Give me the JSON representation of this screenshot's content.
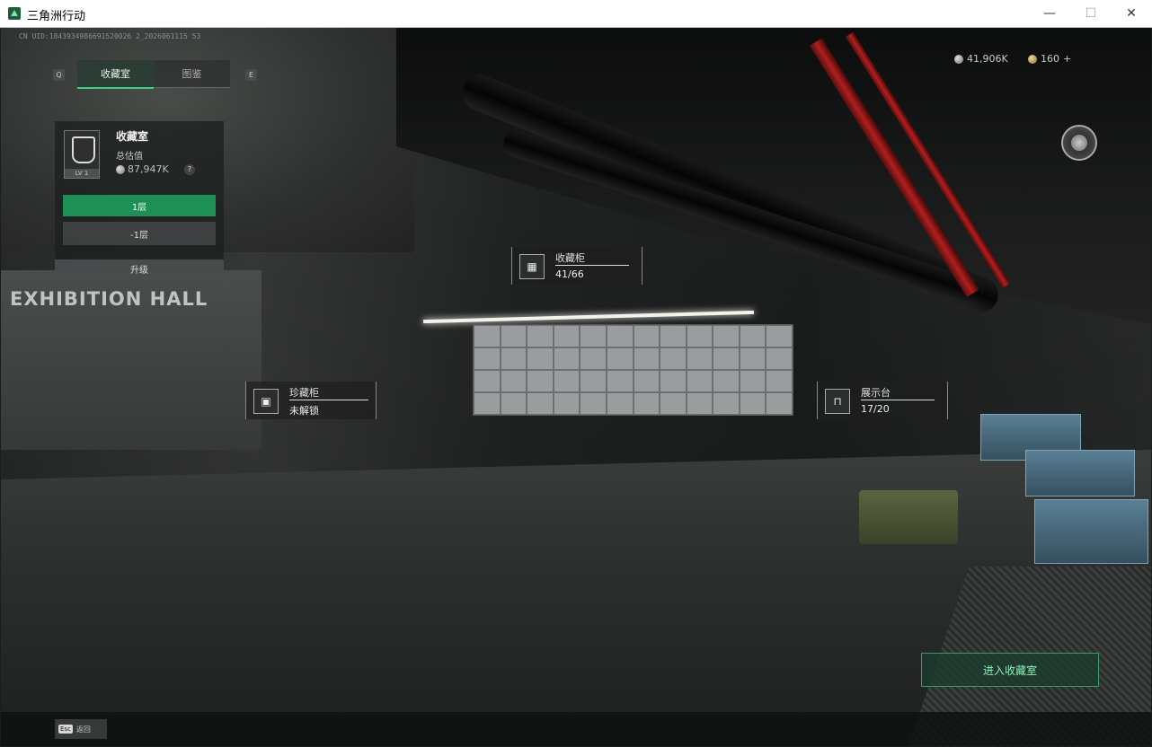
{
  "window": {
    "title": "三角洲行动",
    "minimize": "—",
    "maximize": "☐",
    "close": "✕"
  },
  "uid": "CN UID:1843934986691520026 2_2026061115 53",
  "tabs": {
    "key_left": "Q",
    "key_right": "E",
    "items": [
      "收藏室",
      "图鉴"
    ]
  },
  "collection_panel": {
    "title": "收藏室",
    "subtitle": "总估值",
    "value": "87,947K",
    "help": "?",
    "level": "LV 1",
    "floors": [
      "1层",
      "-1层"
    ],
    "upgrade": "升级"
  },
  "currency": {
    "amount1": "41,906K",
    "amount2": "160",
    "add": "+"
  },
  "scene_text": {
    "hall": "EXHIBITION HALL"
  },
  "markers": {
    "cabinet": {
      "label": "收藏柜",
      "value": "41/66"
    },
    "treasure": {
      "label": "珍藏柜",
      "value": "未解锁"
    },
    "stand": {
      "label": "展示台",
      "value": "17/20"
    }
  },
  "enter_button": "进入收藏室",
  "bottom": {
    "esc_key": "Esc",
    "esc_label": "返回"
  }
}
